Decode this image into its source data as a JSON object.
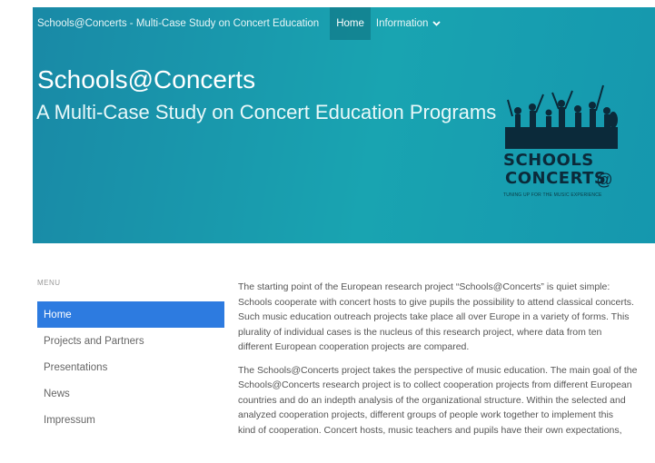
{
  "topbar": {
    "site_name": "Schools@Concerts - Multi-Case Study on Concert Education",
    "nav_home": "Home",
    "nav_information": "Information",
    "chevron_icon": "chevron-down-icon"
  },
  "hero": {
    "title": "Schools@Concerts",
    "subtitle": "A Multi-Case Study on Concert Education Programs",
    "logo": {
      "line1": "SCHOOLS",
      "line2": "CONCERTS",
      "at": "@",
      "tagline": "TUNING UP FOR THE MUSIC EXPERIENCE"
    }
  },
  "sidebar": {
    "label": "MENU",
    "items": [
      {
        "label": "Home",
        "active": true
      },
      {
        "label": "Projects and Partners",
        "active": false
      },
      {
        "label": "Presentations",
        "active": false
      },
      {
        "label": "News",
        "active": false
      },
      {
        "label": "Impressum",
        "active": false
      }
    ]
  },
  "content": {
    "paragraph1": [
      "The starting point of the European research project “Schools@Concerts” is quiet simple:",
      "Schools cooperate with concert hosts to give pupils the possibility to attend classical concerts.",
      "Such music education outreach projects take place all over Europe in a variety of forms. This",
      "plurality of individual cases is the nucleus of this research project, where data from ten",
      "different European cooperation projects are compared."
    ],
    "paragraph2": [
      "The Schools@Concerts project takes the perspective of music education. The main goal of the",
      "Schools@Concerts research project is to collect cooperation projects from different European",
      "countries and do an indepth analysis of the organizational structure. Within the selected and",
      "analyzed cooperation projects, different groups of people work together to implement this",
      "kind of cooperation. Concert hosts, music teachers and pupils have their own expectations,"
    ]
  },
  "colors": {
    "hero_gradient_start": "#1989a6",
    "hero_gradient_end": "#19a4b1",
    "active_menu": "#2d7be0",
    "logo_dark": "#0b2a3a"
  }
}
